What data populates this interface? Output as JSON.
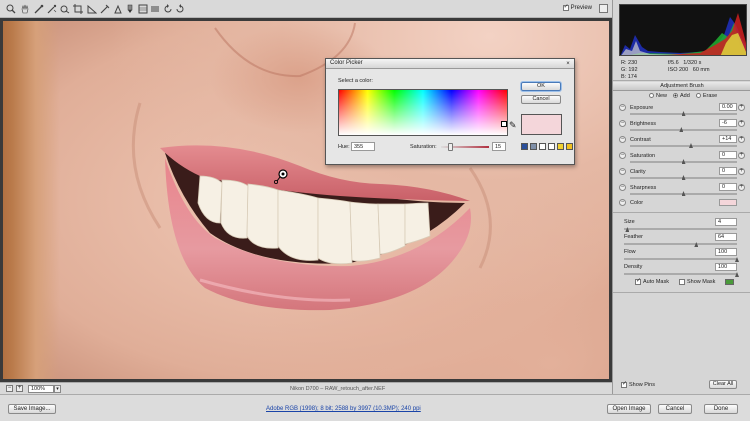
{
  "toolbar": {
    "tools": [
      "zoom-tool-icon",
      "hand-tool-icon",
      "white-balance-tool-icon",
      "color-sampler-tool-icon",
      "targeted-adjustment-tool-icon",
      "crop-tool-icon",
      "straighten-tool-icon",
      "spot-removal-tool-icon",
      "red-eye-removal-tool-icon",
      "adjustment-brush-icon",
      "graduated-filter-icon",
      "open-preferences-icon",
      "rotate-left-icon",
      "rotate-right-icon"
    ],
    "preview_label": "Preview",
    "preview_checked": true
  },
  "color_picker": {
    "title": "Color Picker",
    "prompt": "Select a color:",
    "hue_label": "Hue:",
    "hue_value": "355",
    "saturation_label": "Saturation:",
    "saturation_value": "15",
    "ok_label": "OK",
    "cancel_label": "Cancel",
    "selected_color": "#f4d6da",
    "swatches": [
      "#2a4f9a",
      "#7f8fa8",
      "#ffffff",
      "#ffffff",
      "#f0d030",
      "#f0c020"
    ]
  },
  "statusbar": {
    "zoom": "100%",
    "filename": "Nikon D700  –  RAW_retouch_after.NEF"
  },
  "bottom": {
    "save_label": "Save Image...",
    "workflow_link": "Adobe RGB (1998); 8 bit; 2588 by 3997 (10.3MP); 240 ppi",
    "open_label": "Open Image",
    "cancel_label": "Cancel",
    "done_label": "Done"
  },
  "info": {
    "r_label": "R:",
    "r_value": "230",
    "g_label": "G:",
    "g_value": "192",
    "b_label": "B:",
    "b_value": "174",
    "aperture": "f/5.6",
    "shutter": "1/320 s",
    "iso": "ISO 200",
    "focal": "60 mm"
  },
  "panel": {
    "title": "Adjustment Brush",
    "mode_new": "New",
    "mode_add": "Add",
    "mode_erase": "Erase",
    "adjustments": [
      {
        "label": "Exposure",
        "value": "0.00",
        "pos": 0.5
      },
      {
        "label": "Brightness",
        "value": "-6",
        "pos": 0.48
      },
      {
        "label": "Contrast",
        "value": "+14",
        "pos": 0.57
      },
      {
        "label": "Saturation",
        "value": "0",
        "pos": 0.5
      },
      {
        "label": "Clarity",
        "value": "0",
        "pos": 0.5
      },
      {
        "label": "Sharpness",
        "value": "0",
        "pos": 0.5
      }
    ],
    "color_label": "Color",
    "color_value": "#f4d6da",
    "brush": [
      {
        "label": "Size",
        "value": "4",
        "pos": 0.03
      },
      {
        "label": "Feather",
        "value": "64",
        "pos": 0.64
      },
      {
        "label": "Flow",
        "value": "100",
        "pos": 1.0
      },
      {
        "label": "Density",
        "value": "100",
        "pos": 1.0
      }
    ],
    "auto_mask_label": "Auto Mask",
    "auto_mask_checked": true,
    "show_mask_label": "Show Mask",
    "show_mask_checked": false,
    "mask_color": "#4a9a3a",
    "show_pins_label": "Show Pins",
    "show_pins_checked": true,
    "clear_all_label": "Clear All"
  }
}
